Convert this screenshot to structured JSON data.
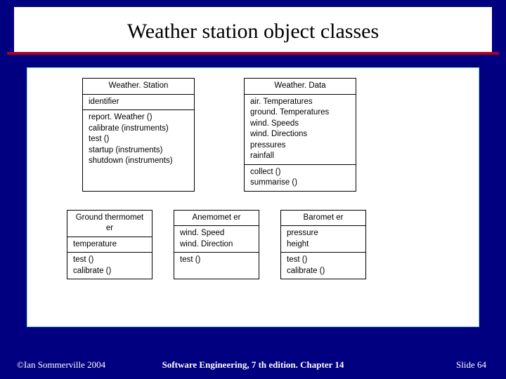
{
  "title": "Weather station object classes",
  "classes": {
    "weather_station": {
      "name": "Weather. Station",
      "attrs": [
        "identifier"
      ],
      "ops": [
        "report. Weather ()",
        "calibrate (instruments)",
        "test ()",
        "startup (instruments)",
        "shutdown (instruments)"
      ]
    },
    "weather_data": {
      "name": "Weather. Data",
      "attrs": [
        "air. Temperatures",
        "ground. Temperatures",
        "wind. Speeds",
        "wind. Directions",
        "pressures",
        "rainfall"
      ],
      "ops": [
        "collect ()",
        "summarise ()"
      ]
    },
    "ground_thermometer": {
      "name": "Ground thermomet er",
      "attrs": [
        "temperature"
      ],
      "ops": [
        "test ()",
        "calibrate ()"
      ]
    },
    "anemometer": {
      "name": "Anemomet er",
      "attrs": [
        "wind. Speed",
        "wind. Direction"
      ],
      "ops": [
        "test ()"
      ]
    },
    "barometer": {
      "name": "Baromet er",
      "attrs": [
        "pressure",
        "height"
      ],
      "ops": [
        "test ()",
        "calibrate ()"
      ]
    }
  },
  "footer": {
    "left": "©Ian Sommerville 2004",
    "center": "Software Engineering, 7 th edition. Chapter 14",
    "right": "Slide 64"
  }
}
